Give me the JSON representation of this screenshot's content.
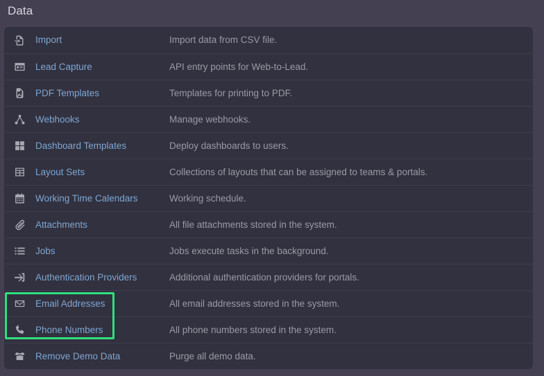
{
  "page": {
    "title": "Data",
    "accent_link_color": "#7ea6d2",
    "highlight_color": "#2fe07f",
    "panel_bg": "#32313f",
    "body_bg": "#453f52"
  },
  "rows": [
    {
      "icon": "file-import-icon",
      "name": "Import",
      "description": "Import data from CSV file."
    },
    {
      "icon": "id-card-icon",
      "name": "Lead Capture",
      "description": "API entry points for Web-to-Lead."
    },
    {
      "icon": "file-pdf-icon",
      "name": "PDF Templates",
      "description": "Templates for printing to PDF."
    },
    {
      "icon": "sitemap-icon",
      "name": "Webhooks",
      "description": "Manage webhooks."
    },
    {
      "icon": "dashboard-grid-icon",
      "name": "Dashboard Templates",
      "description": "Deploy dashboards to users."
    },
    {
      "icon": "table-icon",
      "name": "Layout Sets",
      "description": "Collections of layouts that can be assigned to teams & portals."
    },
    {
      "icon": "calendar-icon",
      "name": "Working Time Calendars",
      "description": "Working schedule."
    },
    {
      "icon": "paperclip-icon",
      "name": "Attachments",
      "description": "All file attachments stored in the system."
    },
    {
      "icon": "list-icon",
      "name": "Jobs",
      "description": "Jobs execute tasks in the background."
    },
    {
      "icon": "sign-in-icon",
      "name": "Authentication Providers",
      "description": "Additional authentication providers for portals."
    },
    {
      "icon": "envelope-icon",
      "name": "Email Addresses",
      "description": "All email addresses stored in the system."
    },
    {
      "icon": "phone-icon",
      "name": "Phone Numbers",
      "description": "All phone numbers stored in the system."
    },
    {
      "icon": "box-open-icon",
      "name": "Remove Demo Data",
      "description": "Purge all demo data."
    }
  ]
}
